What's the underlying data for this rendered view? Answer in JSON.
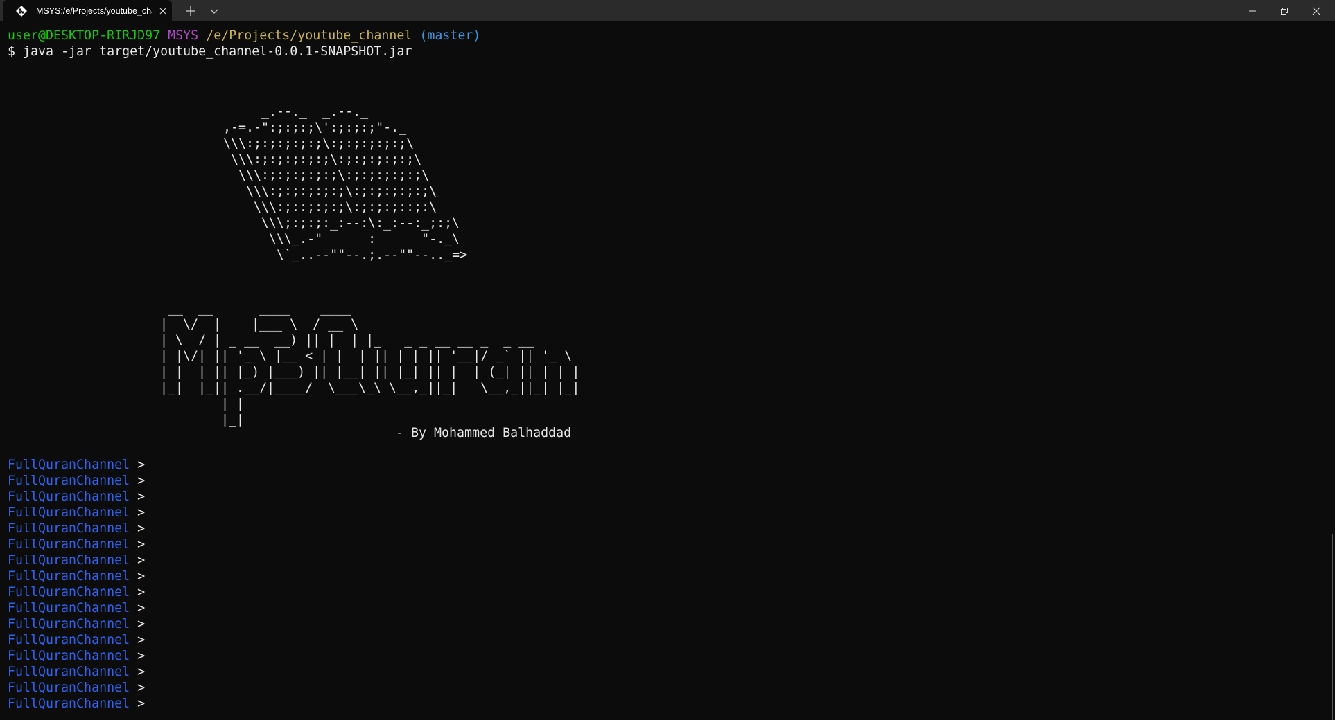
{
  "window": {
    "tab_title": "MSYS:/e/Projects/youtube_channel",
    "tab_icon": "git-bash-diamond-icon",
    "colors": {
      "titlebar": "#2b2b2b",
      "terminal_background": "#0c0c0c",
      "prompt_user": "#16c60c",
      "prompt_msys": "#b148c6",
      "prompt_path": "#c9b54a",
      "prompt_branch": "#3a96dd",
      "channel_prompt": "#2b64f0"
    }
  },
  "shell": {
    "user_host": "user@DESKTOP-RIRJD97",
    "system": "MSYS",
    "cwd": "/e/Projects/youtube_channel",
    "branch": "(master)",
    "command_line": "$ java -jar target/youtube_channel-0.0.1-SNAPSHOT.jar"
  },
  "banner": {
    "book_art": "     _.--._  _.--._\n,-=.-\":;:;:;\\':;:;:;\"-._\n\\\\\\:;:;:;:;:;\\:;:;:;:;:;\\\n \\\\\\:;:;:;:;:;\\:;:;:;:;:;\\\n  \\\\\\:;:;:;:;:;\\:;:;:;:;:;\\\n   \\\\\\:;:;:;:;:;\\:;:;:;:;:;\\\n    \\\\\\:;::;:;:;\\:;:;:;::;:\\\n     \\\\\\;:;:;:_:--:\\:_:--:_;:;\\\n      \\\\\\_.-\"      :      \"-._\\\n       \\`_..--\"\"--.;.--\"\"--.._=>",
    "logo_art": " __  __      ____    ____\n|  \\/  |    |___ \\  / __ \\\n| \\  / | _ __  __) || |  | |_   _ _ __ __ _  _ __\n| |\\/| || '_ \\ |__ < | |  | || | | || '__|/ _` || '_ \\\n| |  | || |_) |___) || |__| || |_| || |  | (_| || | | |\n|_|  |_|| .__/|____/  \\___\\_\\ \\__,_||_|   \\__,_||_| |_|\n        | |\n        |_|",
    "byline": "- By Mohammed Balhaddad"
  },
  "prompts": [
    {
      "name": "FullQuranChannel",
      "symbol": ">"
    },
    {
      "name": "FullQuranChannel",
      "symbol": ">"
    },
    {
      "name": "FullQuranChannel",
      "symbol": ">"
    },
    {
      "name": "FullQuranChannel",
      "symbol": ">"
    },
    {
      "name": "FullQuranChannel",
      "symbol": ">"
    },
    {
      "name": "FullQuranChannel",
      "symbol": ">"
    },
    {
      "name": "FullQuranChannel",
      "symbol": ">"
    },
    {
      "name": "FullQuranChannel",
      "symbol": ">"
    },
    {
      "name": "FullQuranChannel",
      "symbol": ">"
    },
    {
      "name": "FullQuranChannel",
      "symbol": ">"
    },
    {
      "name": "FullQuranChannel",
      "symbol": ">"
    },
    {
      "name": "FullQuranChannel",
      "symbol": ">"
    },
    {
      "name": "FullQuranChannel",
      "symbol": ">"
    },
    {
      "name": "FullQuranChannel",
      "symbol": ">"
    },
    {
      "name": "FullQuranChannel",
      "symbol": ">"
    },
    {
      "name": "FullQuranChannel",
      "symbol": ">"
    }
  ]
}
